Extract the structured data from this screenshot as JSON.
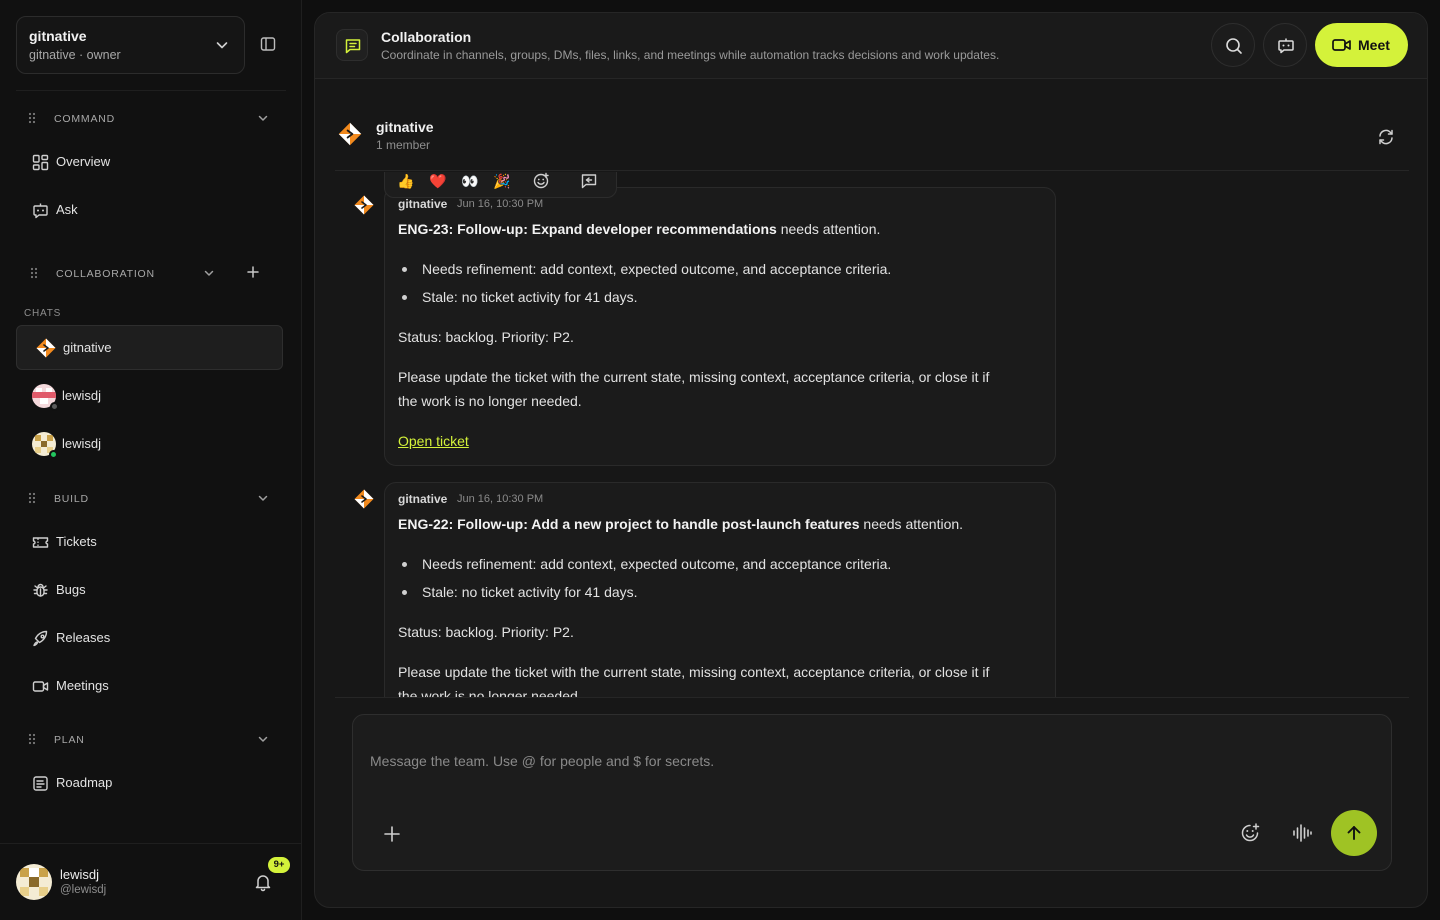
{
  "workspace": {
    "name": "gitnative",
    "subtitle": "gitnative · owner"
  },
  "sections": {
    "command": {
      "title": "COMMAND",
      "items": [
        {
          "label": "Overview",
          "icon": "grid-icon"
        },
        {
          "label": "Ask",
          "icon": "chat-bot-icon"
        }
      ]
    },
    "collaboration": {
      "title": "COLLABORATION",
      "chats_label": "CHATS",
      "chats": [
        {
          "label": "gitnative",
          "active": true
        },
        {
          "label": "lewisdj",
          "presence": "offline"
        },
        {
          "label": "lewisdj",
          "presence": "online"
        }
      ]
    },
    "build": {
      "title": "BUILD",
      "items": [
        {
          "label": "Tickets"
        },
        {
          "label": "Bugs"
        },
        {
          "label": "Releases"
        },
        {
          "label": "Meetings"
        }
      ]
    },
    "plan": {
      "title": "PLAN",
      "items": [
        {
          "label": "Roadmap"
        }
      ]
    }
  },
  "user": {
    "name": "lewisdj",
    "handle": "@lewisdj",
    "notifications": "9+"
  },
  "header": {
    "title": "Collaboration",
    "subtitle": "Coordinate in channels, groups, DMs, files, links, and meetings while automation tracks decisions and work updates.",
    "meet_label": "Meet"
  },
  "channel": {
    "name": "gitnative",
    "members": "1 member"
  },
  "reactions": [
    "👍",
    "❤️",
    "👀",
    "🎉"
  ],
  "messages": [
    {
      "author": "gitnative",
      "time": "Jun 16, 10:30 PM",
      "title": "ENG-23: Follow-up: Expand developer recommendations",
      "title_suffix": " needs attention.",
      "bullets": [
        "Needs refinement: add context, expected outcome, and acceptance criteria.",
        "Stale: no ticket activity for 41 days."
      ],
      "status": "Status: backlog. Priority: P2.",
      "body_1": "Please update the ticket with the current state, missing context, acceptance criteria, or close it if",
      "body_2": "the work is no longer needed.",
      "link": "Open ticket"
    },
    {
      "author": "gitnative",
      "time": "Jun 16, 10:30 PM",
      "title": "ENG-22: Follow-up: Add a new project to handle post-launch features",
      "title_suffix": " needs attention.",
      "bullets": [
        "Needs refinement: add context, expected outcome, and acceptance criteria.",
        "Stale: no ticket activity for 41 days."
      ],
      "status": "Status: backlog. Priority: P2.",
      "body_1": "Please update the ticket with the current state, missing context, acceptance criteria, or close it if",
      "body_2": "the work is no longer needed."
    }
  ],
  "composer": {
    "placeholder": "Message the team. Use @ for people and $ for secrets."
  },
  "colors": {
    "accent": "#d4f23a",
    "send": "#9fc324",
    "background": "#0f0f0f",
    "panel": "#171717"
  }
}
